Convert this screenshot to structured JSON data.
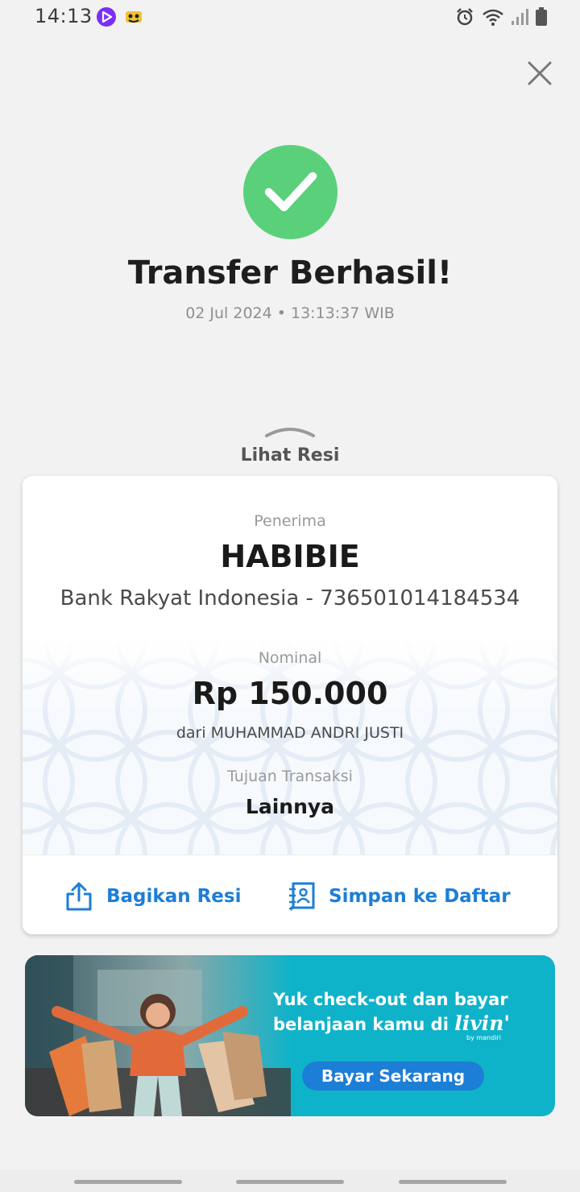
{
  "status_bar": {
    "time": "14:13",
    "icons": [
      "media-app-icon",
      "game-app-icon",
      "alarm-icon",
      "wifi-icon",
      "signal-icon",
      "battery-icon"
    ]
  },
  "header": {
    "close_icon": "close-icon",
    "success_icon": "check-circle-icon",
    "title": "Transfer Berhasil!",
    "timestamp": "02 Jul 2024 • 13:13:37 WIB"
  },
  "receipt_toggle": {
    "label": "Lihat Resi",
    "icon": "chevron-up-icon"
  },
  "receipt": {
    "recipient_label": "Penerima",
    "recipient_name": "HABIBIE",
    "recipient_bank": "Bank Rakyat Indonesia - 736501014184534",
    "nominal_label": "Nominal",
    "amount": "Rp 150.000",
    "sender": "dari MUHAMMAD ANDRI JUSTI",
    "purpose_label": "Tujuan Transaksi",
    "purpose": "Lainnya"
  },
  "actions": {
    "share_label": "Bagikan Resi",
    "save_label": "Simpan ke Daftar"
  },
  "promo": {
    "line1": "Yuk check-out dan bayar",
    "line2_prefix": "belanjaan kamu di",
    "brand": "livin'",
    "brand_sub": "by mandiri",
    "button_label": "Bayar Sekarang"
  },
  "colors": {
    "accent_blue": "#1c7ed6",
    "success_green": "#5ad07a",
    "banner_teal": "#0fb3c9"
  }
}
